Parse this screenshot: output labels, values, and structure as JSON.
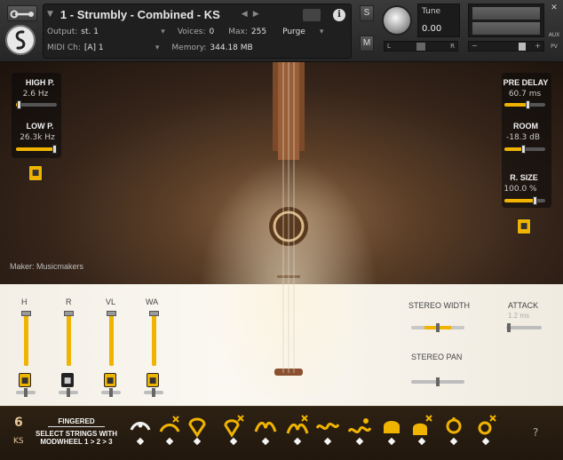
{
  "header": {
    "instrument_title": "1 - Strumbly - Combined - KS",
    "output_label": "Output:",
    "output_value": "st. 1",
    "midi_label": "MIDI Ch:",
    "midi_value": "[A] 1",
    "voices_label": "Voices:",
    "voices_value": "0",
    "max_label": "Max:",
    "max_value": "255",
    "purge_label": "Purge",
    "memory_label": "Memory:",
    "memory_value": "344.18 MB",
    "solo_label": "S",
    "mute_label": "M",
    "tune_label": "Tune",
    "tune_value": "0.00",
    "pan_left": "L",
    "pan_right": "R",
    "aux_label": "AUX",
    "pv_label": "PV"
  },
  "main": {
    "maker": "Maker: Musicmakers",
    "high_pass": {
      "label": "HIGH P.",
      "value": "2.6 Hz",
      "level": 0.05
    },
    "low_pass": {
      "label": "LOW P.",
      "value": "26.3k Hz",
      "level": 0.98
    },
    "pre_delay": {
      "label": "PRE DELAY",
      "value": "60.7 ms",
      "level": 0.55
    },
    "room": {
      "label": "ROOM",
      "value": "-18.3 dB",
      "level": 0.45
    },
    "reverb_size": {
      "label": "R. SIZE",
      "value": "100.0 %",
      "level": 0.75
    },
    "mixer": [
      {
        "label": "H",
        "level": 0.95,
        "lock": "on"
      },
      {
        "label": "R",
        "level": 0.95,
        "lock": "off"
      },
      {
        "label": "VL",
        "level": 0.95,
        "lock": "on"
      },
      {
        "label": "WA",
        "level": 0.95,
        "lock": "on"
      }
    ],
    "stereo_width": {
      "label": "STEREO WIDTH",
      "level": 0.5
    },
    "attack": {
      "label": "ATTACK",
      "value": "1.2 ms",
      "level": 0.05
    },
    "stereo_pan": {
      "label": "STEREO PAN",
      "level": 0.5
    }
  },
  "bottom": {
    "counter": "6",
    "mode": "KS",
    "articulation_name": "FINGERED",
    "hint_line1": "SELECT STRINGS WITH",
    "hint_line2": "MODWHEEL 1 > 2 > 3",
    "articulations": [
      "pick-arc-icon",
      "pick-arc-x-icon",
      "pick-drop-icon",
      "pick-drop-x-icon",
      "pick-loop-icon",
      "pick-loop-x-icon",
      "slide-wave-icon",
      "slide-wave-x-icon",
      "tremolo-icon",
      "tremolo-x-icon",
      "ring-icon",
      "ring-x-icon",
      "pluck-icon",
      "pluck-x-icon"
    ],
    "help": "?"
  },
  "colors": {
    "accent": "#f0b400",
    "header_bg": "#2f2f2f",
    "bottom_bg": "#2a1d10"
  }
}
